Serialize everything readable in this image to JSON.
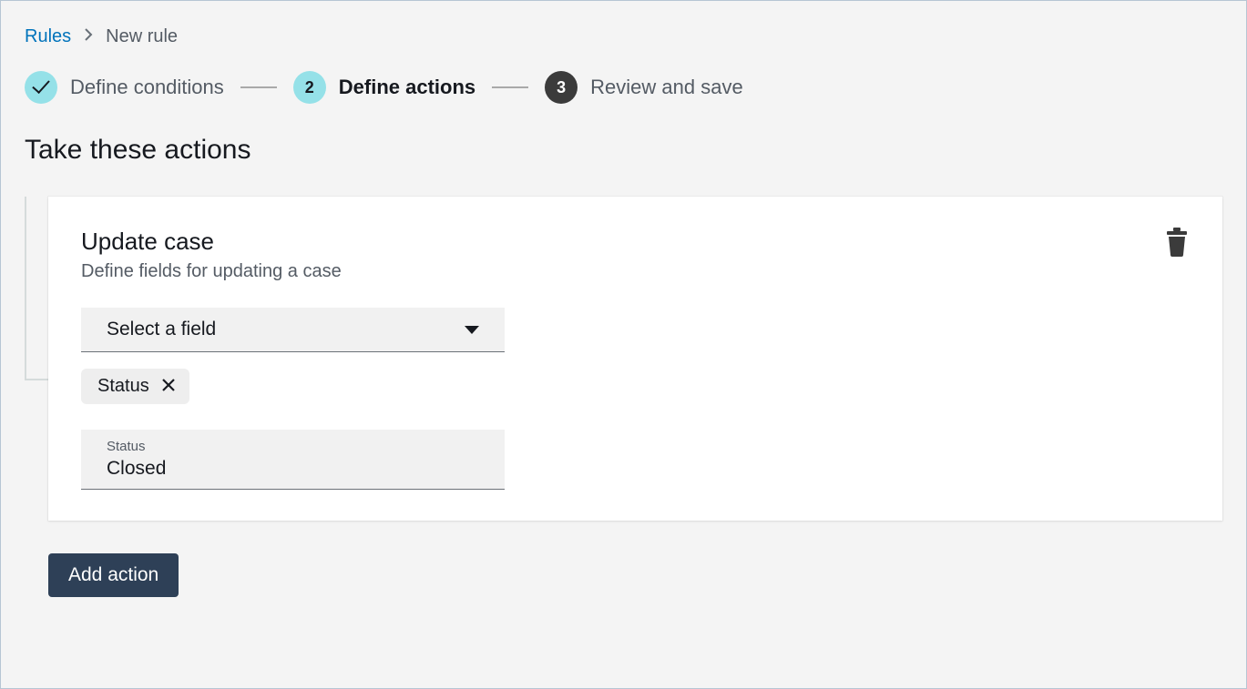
{
  "breadcrumb": {
    "root": "Rules",
    "current": "New rule"
  },
  "steps": [
    {
      "label": "Define conditions",
      "state": "completed"
    },
    {
      "num": "2",
      "label": "Define actions",
      "state": "active"
    },
    {
      "num": "3",
      "label": "Review and save",
      "state": "future"
    }
  ],
  "section": {
    "heading": "Take these actions"
  },
  "actionCard": {
    "title": "Update case",
    "subtitle": "Define fields for updating a case",
    "fieldSelect": {
      "placeholder": "Select a field"
    },
    "chip": {
      "label": "Status"
    },
    "statusSelect": {
      "label": "Status",
      "value": "Closed"
    }
  },
  "buttons": {
    "addAction": "Add action"
  }
}
